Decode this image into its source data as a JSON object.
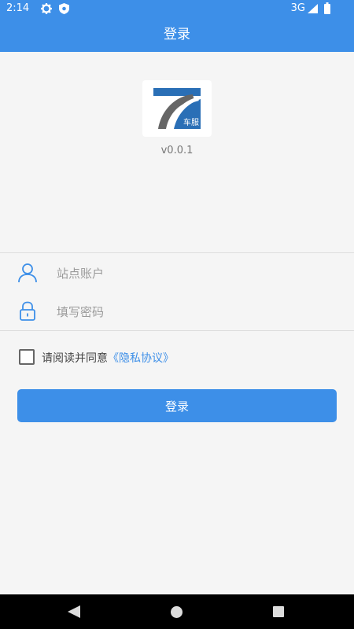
{
  "status_bar": {
    "time": "2:14",
    "network": "3G",
    "icons": [
      "gear-icon",
      "shield-icon",
      "signal-icon",
      "battery-icon"
    ]
  },
  "app_bar": {
    "title": "登录"
  },
  "logo": {
    "text": "车服"
  },
  "version": "v0.0.1",
  "form": {
    "account_placeholder": "站点账户",
    "password_placeholder": "填写密码"
  },
  "agreement": {
    "text": "请阅读并同意",
    "link": "《隐私协议》",
    "checked": false
  },
  "login_button": {
    "label": "登录"
  },
  "colors": {
    "primary": "#3d8fe8",
    "background": "#f5f5f5"
  }
}
